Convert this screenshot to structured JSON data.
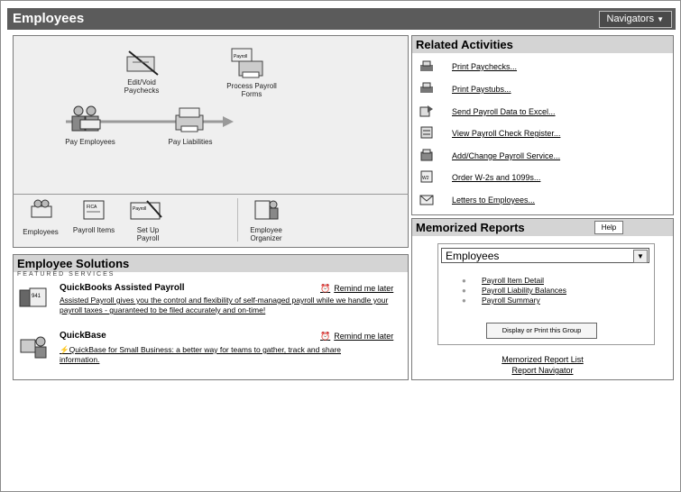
{
  "window": {
    "title": "Employees",
    "navigators_label": "Navigators"
  },
  "workflow": {
    "edit_void": "Edit/Void Paychecks",
    "process_forms": "Process Payroll Forms",
    "pay_employees": "Pay Employees",
    "pay_liabilities": "Pay Liabilities"
  },
  "shortcuts": {
    "employees": "Employees",
    "payroll_items": "Payroll Items",
    "setup_payroll": "Set Up Payroll",
    "employee_organizer": "Employee Organizer"
  },
  "solutions": {
    "title": "Employee Solutions",
    "featured": "FEATURED SERVICES",
    "services": [
      {
        "title": "QuickBooks Assisted Payroll",
        "remind": "Remind me later",
        "desc": "Assisted Payroll gives you the control and flexibility of self-managed payroll while we handle your payroll taxes - guaranteed to be filed accurately and on-time!"
      },
      {
        "title": "QuickBase",
        "remind": "Remind me later",
        "desc": "QuickBase for Small Business: a better way for teams to gather, track and share information."
      }
    ]
  },
  "related": {
    "title": "Related Activities",
    "items": [
      "Print Paychecks...",
      "Print Paystubs...",
      "Send Payroll Data to Excel...",
      "View Payroll Check Register...",
      "Add/Change Payroll Service...",
      "Order W-2s and 1099s...",
      "Letters to Employees..."
    ]
  },
  "memorized": {
    "title": "Memorized Reports",
    "help": "Help",
    "selected_group": "Employees",
    "reports": [
      "Payroll Item Detail",
      "Payroll Liability Balances",
      "Payroll Summary"
    ],
    "display_button": "Display or Print this Group",
    "report_list_link": "Memorized Report List",
    "navigator_link": "Report Navigator"
  }
}
